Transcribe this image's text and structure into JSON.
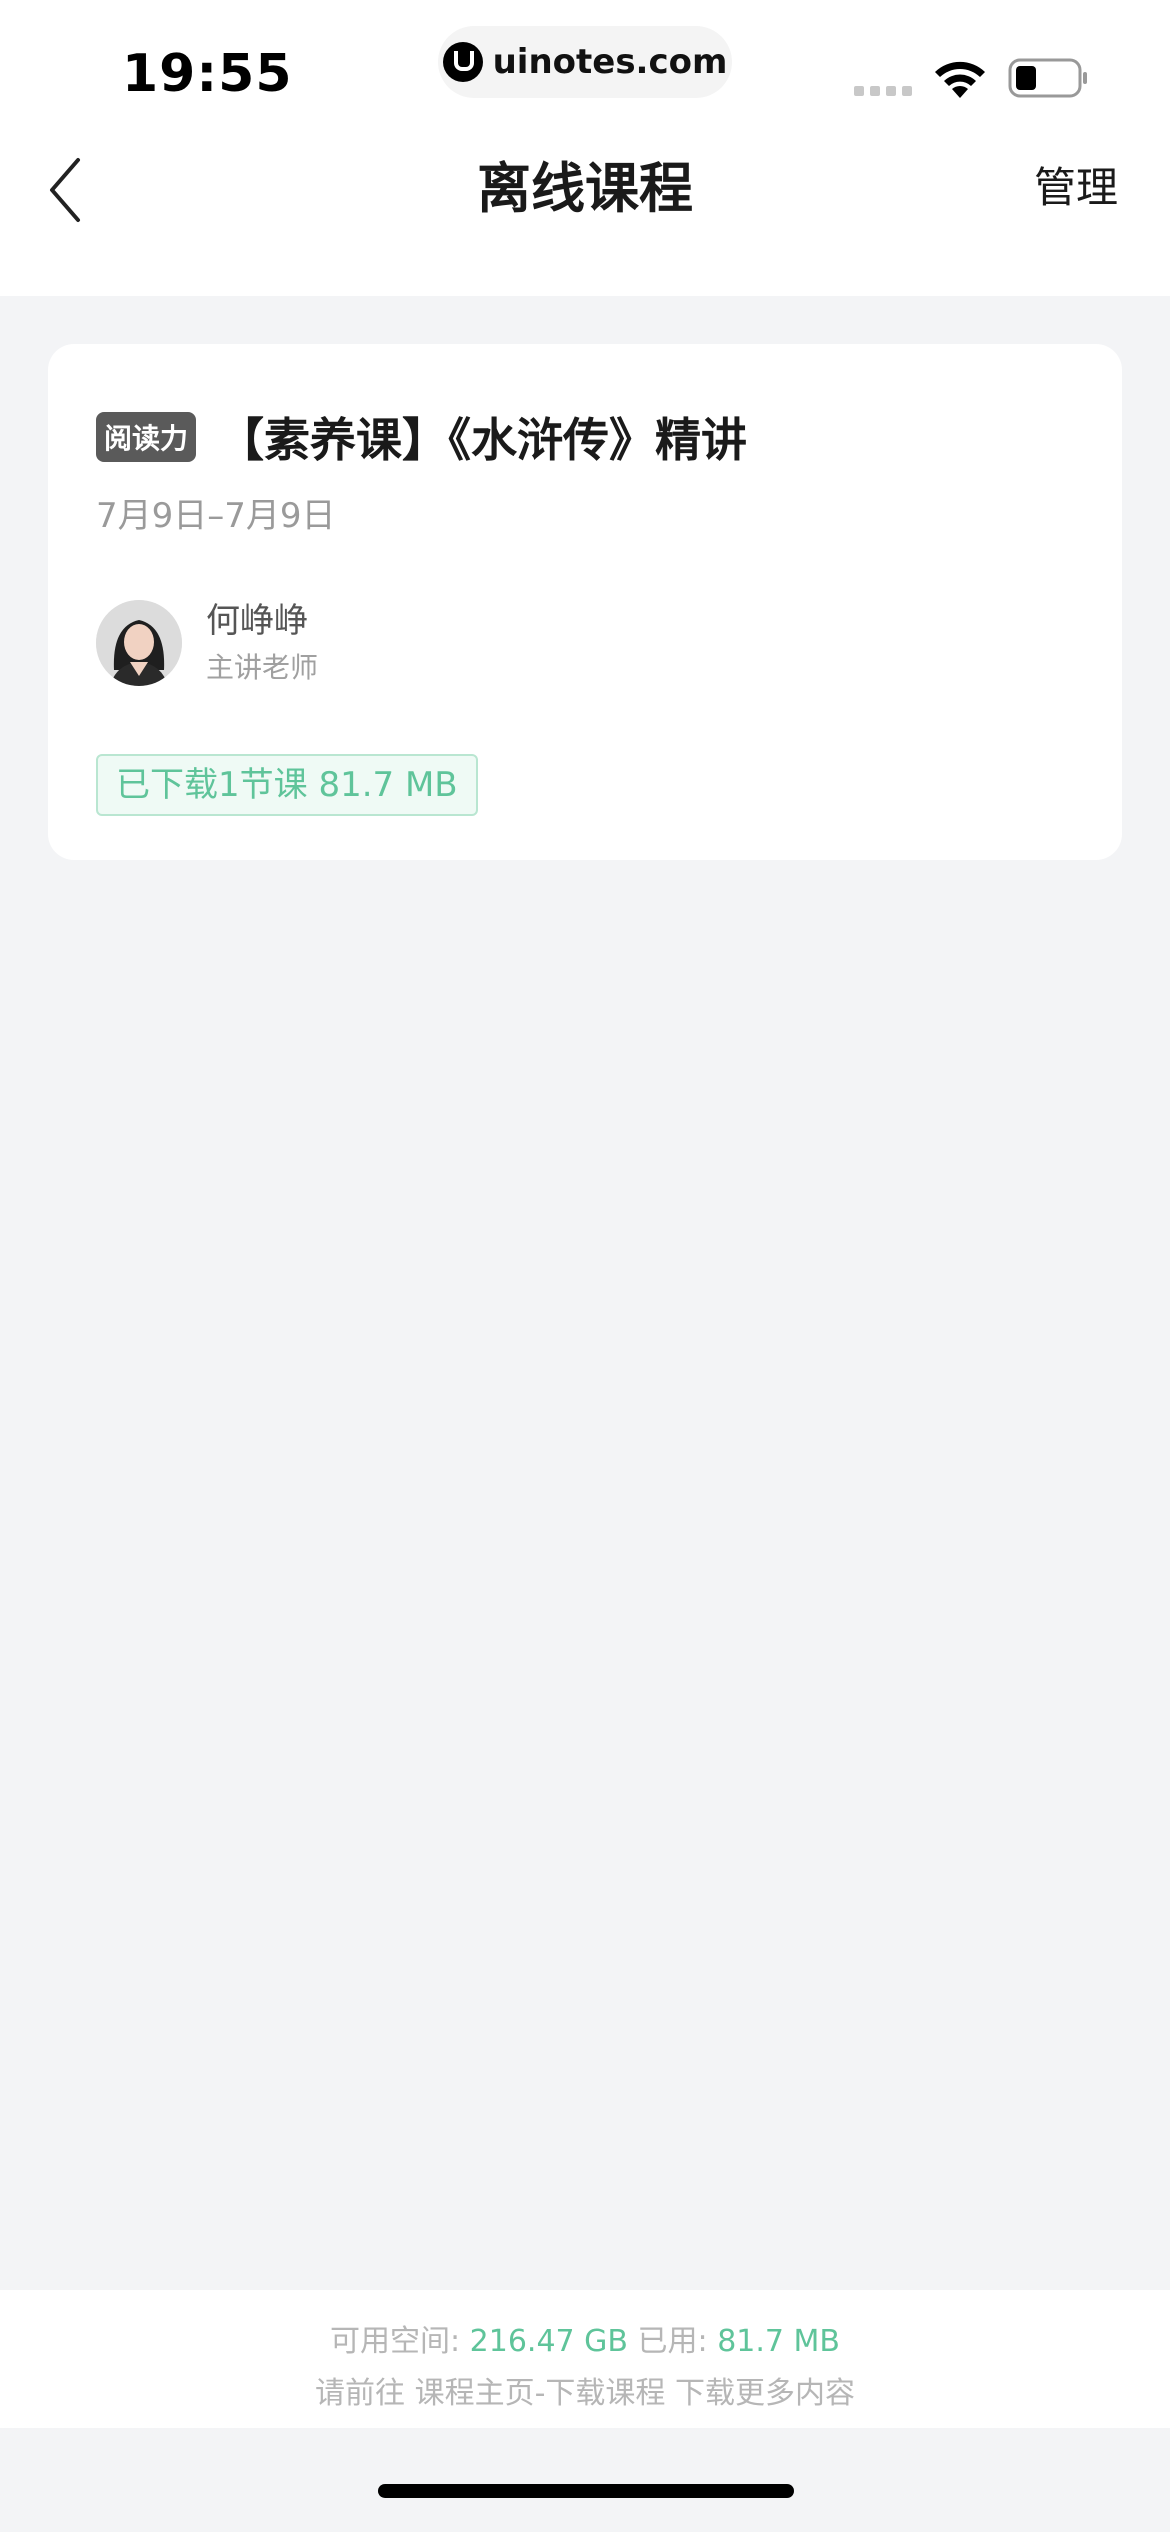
{
  "status_bar": {
    "time": "19:55",
    "url": "uinotes.com"
  },
  "nav": {
    "title": "离线课程",
    "manage_label": "管理"
  },
  "course": {
    "tag": "阅读力",
    "title": "【素养课】《水浒传》精讲",
    "date_range": "7月9日–7月9日",
    "teacher_name": "何峥峥",
    "teacher_role": "主讲老师",
    "download_status": "已下载1节课 81.7 MB"
  },
  "footer": {
    "available_label": "可用空间: ",
    "available_value": "216.47 GB",
    "used_label": " 已用: ",
    "used_value": "81.7 MB",
    "hint_prefix": "请前往 ",
    "hint_link": "课程主页-下载课程",
    "hint_suffix": " 下载更多内容"
  },
  "colors": {
    "accent": "#5fc49a",
    "background": "#f3f4f6",
    "card": "#ffffff",
    "tag_bg": "#5a5a5a"
  }
}
